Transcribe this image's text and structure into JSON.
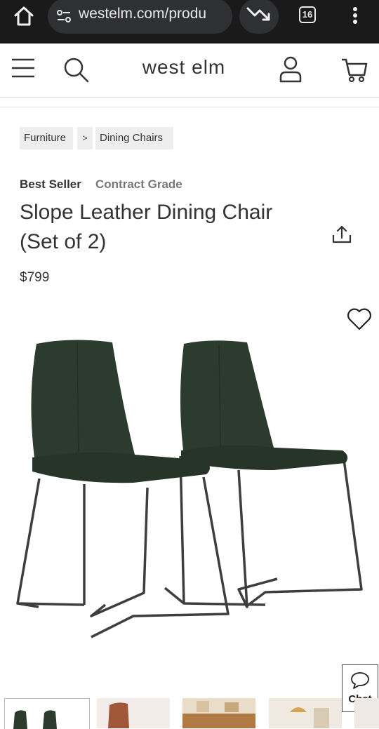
{
  "browser": {
    "url": "westelm.com/produ",
    "tab_count": "16"
  },
  "site": {
    "logo": "west elm"
  },
  "breadcrumb": {
    "items": [
      "Furniture",
      "Dining Chairs"
    ],
    "separator": ">"
  },
  "product": {
    "badges": [
      "Best Seller",
      "Contract Grade"
    ],
    "title": "Slope Leather Dining Chair (Set of 2)",
    "price": "$799"
  },
  "chat": {
    "label": "Chat"
  },
  "colors": {
    "chrome_bg": "#1a1a1a",
    "leather": "#2a3a2b",
    "frame": "#3a3a3a"
  }
}
